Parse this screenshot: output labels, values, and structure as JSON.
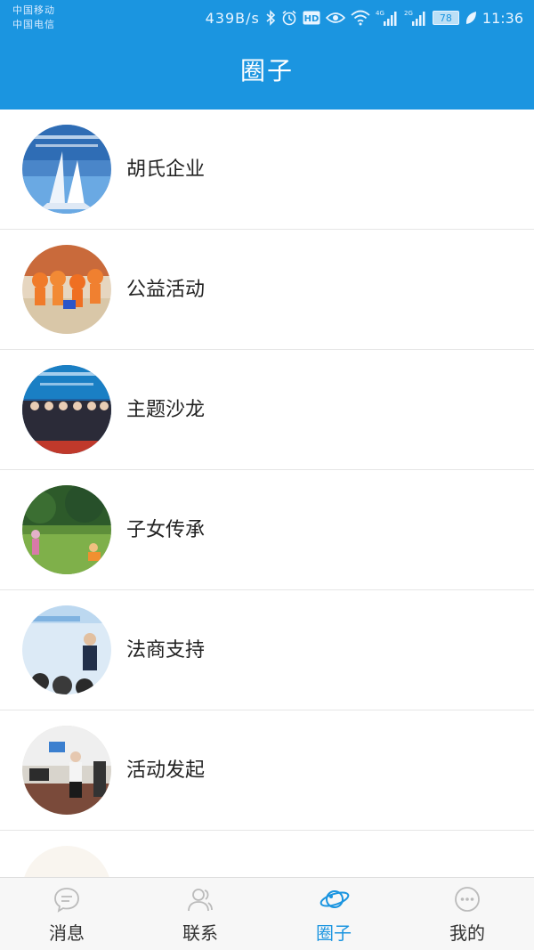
{
  "status_bar": {
    "carrier_1": "中国移动",
    "carrier_2": "中国电信",
    "net_speed": "439B/s",
    "signal_1_label": "4G",
    "signal_2_label": "2G",
    "battery": "78",
    "time": "11:36",
    "icons": [
      "bluetooth-icon",
      "alarm-icon",
      "hd-icon",
      "eye-icon",
      "wifi-icon",
      "signal-icon",
      "battery-icon",
      "leaf-icon"
    ]
  },
  "header": {
    "title": "圈子"
  },
  "circles": [
    {
      "label": "胡氏企业"
    },
    {
      "label": "公益活动"
    },
    {
      "label": "主题沙龙"
    },
    {
      "label": "子女传承"
    },
    {
      "label": "法商支持"
    },
    {
      "label": "活动发起"
    }
  ],
  "tabs": [
    {
      "label": "消息",
      "icon": "message-icon",
      "active": false
    },
    {
      "label": "联系",
      "icon": "contacts-icon",
      "active": false
    },
    {
      "label": "圈子",
      "icon": "planet-icon",
      "active": true
    },
    {
      "label": "我的",
      "icon": "profile-icon",
      "active": false
    }
  ],
  "colors": {
    "primary": "#1b95e0",
    "tab_inactive": "#333333",
    "icon_inactive": "#bbbbbb"
  }
}
